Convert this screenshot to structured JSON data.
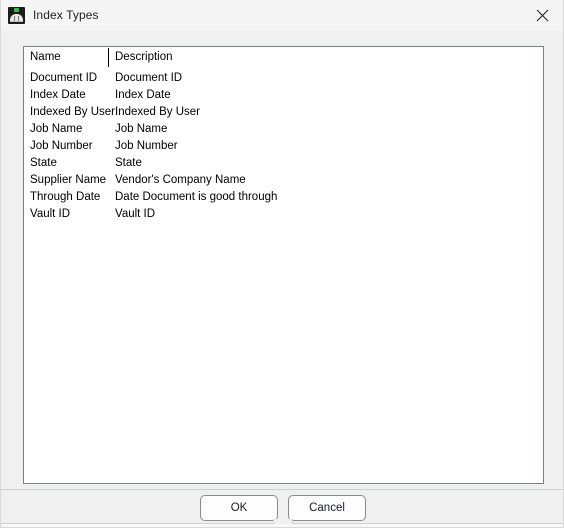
{
  "window": {
    "title": "Index Types",
    "icon": "vault-dome-icon",
    "close_icon": "close-icon"
  },
  "list": {
    "columns": [
      {
        "label": "Name",
        "key": "name"
      },
      {
        "label": "Description",
        "key": "description"
      }
    ],
    "rows": [
      {
        "name": "Document ID",
        "description": "Document ID"
      },
      {
        "name": "Index Date",
        "description": "Index Date"
      },
      {
        "name": "Indexed By User",
        "description": "Indexed By User"
      },
      {
        "name": "Job Name",
        "description": "Job Name"
      },
      {
        "name": "Job Number",
        "description": "Job Number"
      },
      {
        "name": "State",
        "description": "State"
      },
      {
        "name": "Supplier Name",
        "description": "Vendor's Company Name"
      },
      {
        "name": "Through Date",
        "description": "Date Document is good through"
      },
      {
        "name": "Vault ID",
        "description": "Vault ID"
      }
    ]
  },
  "footer": {
    "ok_label": "OK",
    "cancel_label": "Cancel"
  },
  "colors": {
    "titlebar_background": "#f5f5f5",
    "dialog_background": "#f0f0f0",
    "list_background": "#ffffff",
    "list_border": "#7b7f87",
    "text": "#000000",
    "icon_accent": "#2fbf4a"
  }
}
